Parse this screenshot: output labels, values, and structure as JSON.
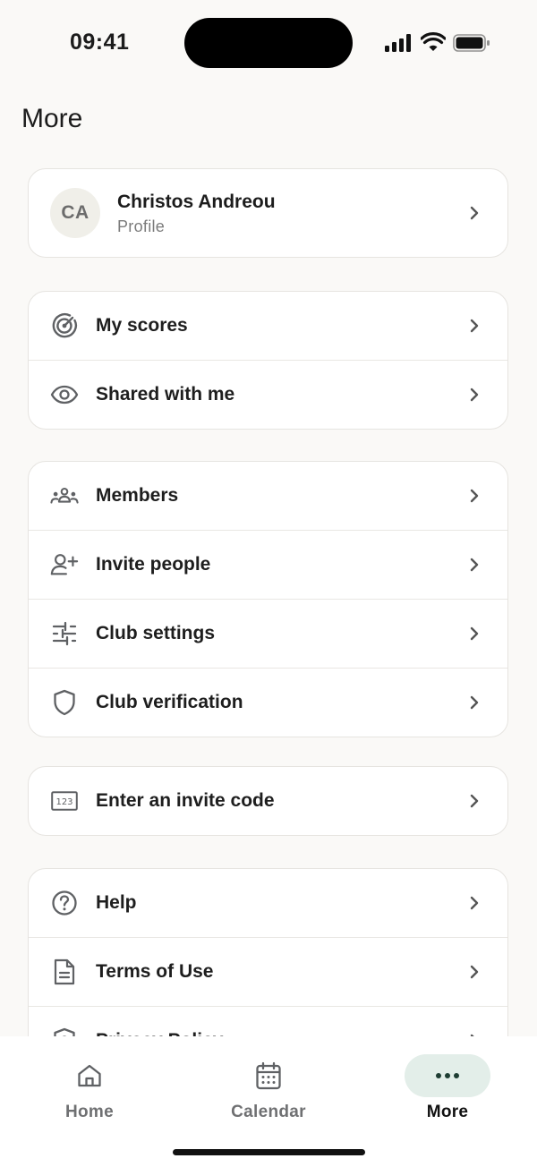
{
  "status": {
    "time": "09:41"
  },
  "page": {
    "title": "More"
  },
  "profile": {
    "initials": "CA",
    "name": "Christos Andreou",
    "subtitle": "Profile"
  },
  "group1": [
    {
      "label": "My scores",
      "icon": "target-icon"
    },
    {
      "label": "Shared with me",
      "icon": "eye-icon"
    }
  ],
  "group2": [
    {
      "label": "Members",
      "icon": "members-icon"
    },
    {
      "label": "Invite people",
      "icon": "add-user-icon"
    },
    {
      "label": "Club settings",
      "icon": "sliders-icon"
    },
    {
      "label": "Club verification",
      "icon": "shield-icon"
    }
  ],
  "group3": [
    {
      "label": "Enter an invite code",
      "icon": "code-123-icon",
      "icon_text": "123"
    }
  ],
  "group4": [
    {
      "label": "Help",
      "icon": "help-circle-icon"
    },
    {
      "label": "Terms of Use",
      "icon": "document-icon"
    },
    {
      "label": "Privacy Policy",
      "icon": "shield-lock-icon"
    }
  ],
  "tabs": [
    {
      "label": "Home",
      "icon": "home-icon"
    },
    {
      "label": "Calendar",
      "icon": "calendar-icon"
    },
    {
      "label": "More",
      "icon": "more-dots-icon",
      "active": true
    }
  ],
  "colors": {
    "background": "#faf9f7",
    "active_pill": "#e3eee9",
    "icon": "#5f6164"
  }
}
